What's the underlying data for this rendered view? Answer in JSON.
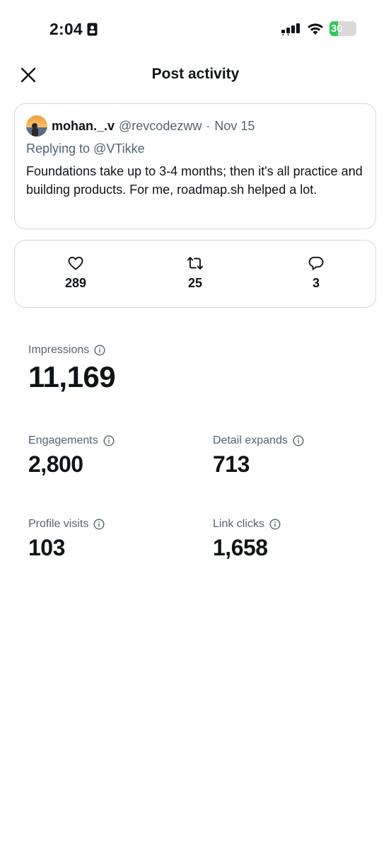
{
  "status_bar": {
    "time": "2:04",
    "battery": "30"
  },
  "header": {
    "title": "Post activity",
    "close_icon": "close-icon"
  },
  "tweet": {
    "author_name": "mohan._.v",
    "author_handle": "@revcodezww",
    "separator": "·",
    "date": "Nov 15",
    "replying_to": "Replying to @VTikke",
    "text": "Foundations take up to 3-4 months; then it's all practice and building products. For me, roadmap.sh helped a lot."
  },
  "actions": {
    "likes": {
      "icon": "heart-icon",
      "count": "289"
    },
    "reposts": {
      "icon": "repost-icon",
      "count": "25"
    },
    "replies": {
      "icon": "reply-icon",
      "count": "3"
    }
  },
  "metrics": {
    "impressions": {
      "label": "Impressions",
      "value": "11,169"
    },
    "engagements": {
      "label": "Engagements",
      "value": "2,800"
    },
    "detail_expands": {
      "label": "Detail expands",
      "value": "713"
    },
    "profile_visits": {
      "label": "Profile visits",
      "value": "103"
    },
    "link_clicks": {
      "label": "Link clicks",
      "value": "1,658"
    }
  },
  "colors": {
    "text_primary": "#0f1419",
    "text_secondary": "#536471",
    "border": "#cfd9de",
    "battery_green": "#34c759"
  }
}
